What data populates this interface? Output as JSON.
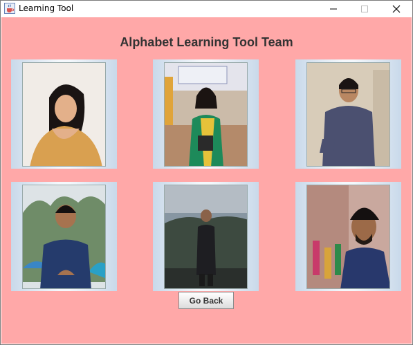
{
  "window": {
    "title": "Learning Tool",
    "icon": "java-cup-icon"
  },
  "main": {
    "heading": "Alphabet Learning Tool Team",
    "photos": [
      {
        "name": "team-photo-1",
        "bg": "#f2ede8",
        "accent": "#d4a056"
      },
      {
        "name": "team-photo-2",
        "bg": "#c9b9a8",
        "accent": "#1d8a5a"
      },
      {
        "name": "team-photo-3",
        "bg": "#d8cbb9",
        "accent": "#4a4e6a"
      },
      {
        "name": "team-photo-4",
        "bg": "#7e9a78",
        "accent": "#243a6a"
      },
      {
        "name": "team-photo-5",
        "bg": "#596a75",
        "accent": "#202020"
      },
      {
        "name": "team-photo-6",
        "bg": "#b98880",
        "accent": "#273a6e"
      }
    ],
    "go_back_label": "Go Back"
  },
  "colors": {
    "panel_bg": "#ffa8a8",
    "heading_color": "#333333"
  }
}
